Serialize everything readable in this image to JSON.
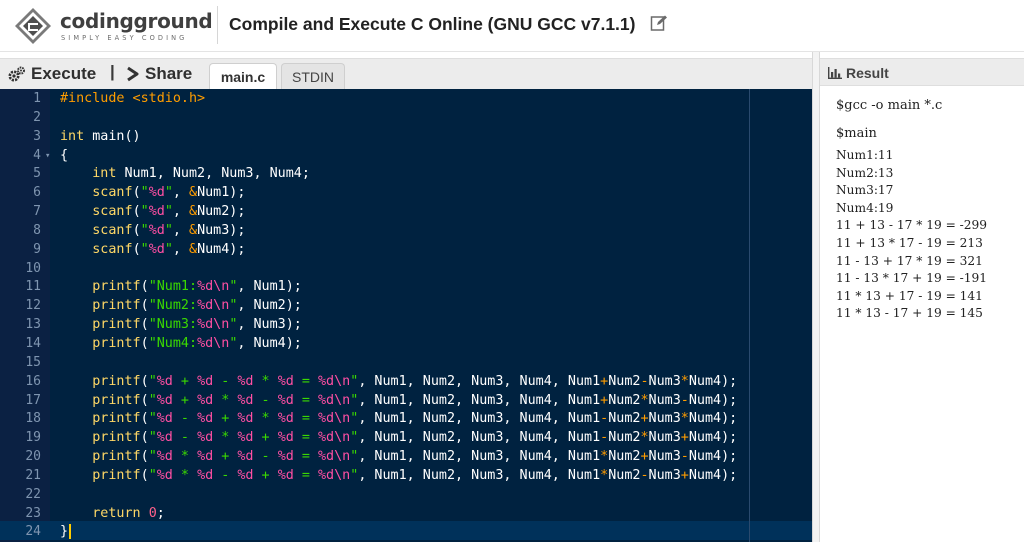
{
  "header": {
    "logo_name": "codingground",
    "logo_tagline": "SIMPLY EASY CODING",
    "page_title": "Compile and Execute C Online (GNU GCC v7.1.1)",
    "edit_icon": "edit-icon"
  },
  "toolbar": {
    "execute_label": "Execute",
    "separator": "|",
    "share_label": "Share",
    "tabs": [
      {
        "label": "main.c",
        "active": true
      },
      {
        "label": "STDIN",
        "active": false
      }
    ]
  },
  "editor": {
    "active_line": 24,
    "lines": [
      {
        "n": "1",
        "tokens": [
          [
            "pp",
            "#include <stdio.h>"
          ]
        ]
      },
      {
        "n": "2",
        "tokens": []
      },
      {
        "n": "3",
        "tokens": [
          [
            "kw",
            "int"
          ],
          [
            "plain",
            " main()"
          ]
        ]
      },
      {
        "n": "4",
        "fold": true,
        "tokens": [
          [
            "plain",
            "{"
          ]
        ]
      },
      {
        "n": "5",
        "tokens": [
          [
            "plain",
            "    "
          ],
          [
            "kw",
            "int"
          ],
          [
            "plain",
            " Num1, Num2, Num3, Num4;"
          ]
        ]
      },
      {
        "n": "6",
        "tokens": [
          [
            "plain",
            "    "
          ],
          [
            "kw",
            "scanf"
          ],
          [
            "plain",
            "("
          ],
          [
            "str",
            "\""
          ],
          [
            "fmt",
            "%d"
          ],
          [
            "str",
            "\""
          ],
          [
            "plain",
            ", "
          ],
          [
            "op",
            "&"
          ],
          [
            "plain",
            "Num1);"
          ]
        ]
      },
      {
        "n": "7",
        "tokens": [
          [
            "plain",
            "    "
          ],
          [
            "kw",
            "scanf"
          ],
          [
            "plain",
            "("
          ],
          [
            "str",
            "\""
          ],
          [
            "fmt",
            "%d"
          ],
          [
            "str",
            "\""
          ],
          [
            "plain",
            ", "
          ],
          [
            "op",
            "&"
          ],
          [
            "plain",
            "Num2);"
          ]
        ]
      },
      {
        "n": "8",
        "tokens": [
          [
            "plain",
            "    "
          ],
          [
            "kw",
            "scanf"
          ],
          [
            "plain",
            "("
          ],
          [
            "str",
            "\""
          ],
          [
            "fmt",
            "%d"
          ],
          [
            "str",
            "\""
          ],
          [
            "plain",
            ", "
          ],
          [
            "op",
            "&"
          ],
          [
            "plain",
            "Num3);"
          ]
        ]
      },
      {
        "n": "9",
        "tokens": [
          [
            "plain",
            "    "
          ],
          [
            "kw",
            "scanf"
          ],
          [
            "plain",
            "("
          ],
          [
            "str",
            "\""
          ],
          [
            "fmt",
            "%d"
          ],
          [
            "str",
            "\""
          ],
          [
            "plain",
            ", "
          ],
          [
            "op",
            "&"
          ],
          [
            "plain",
            "Num4);"
          ]
        ]
      },
      {
        "n": "10",
        "tokens": []
      },
      {
        "n": "11",
        "tokens": [
          [
            "plain",
            "    "
          ],
          [
            "kw",
            "printf"
          ],
          [
            "plain",
            "("
          ],
          [
            "str",
            "\"Num1:"
          ],
          [
            "fmt",
            "%d\\n"
          ],
          [
            "str",
            "\""
          ],
          [
            "plain",
            ", Num1);"
          ]
        ]
      },
      {
        "n": "12",
        "tokens": [
          [
            "plain",
            "    "
          ],
          [
            "kw",
            "printf"
          ],
          [
            "plain",
            "("
          ],
          [
            "str",
            "\"Num2:"
          ],
          [
            "fmt",
            "%d\\n"
          ],
          [
            "str",
            "\""
          ],
          [
            "plain",
            ", Num2);"
          ]
        ]
      },
      {
        "n": "13",
        "tokens": [
          [
            "plain",
            "    "
          ],
          [
            "kw",
            "printf"
          ],
          [
            "plain",
            "("
          ],
          [
            "str",
            "\"Num3:"
          ],
          [
            "fmt",
            "%d\\n"
          ],
          [
            "str",
            "\""
          ],
          [
            "plain",
            ", Num3);"
          ]
        ]
      },
      {
        "n": "14",
        "tokens": [
          [
            "plain",
            "    "
          ],
          [
            "kw",
            "printf"
          ],
          [
            "plain",
            "("
          ],
          [
            "str",
            "\"Num4:"
          ],
          [
            "fmt",
            "%d\\n"
          ],
          [
            "str",
            "\""
          ],
          [
            "plain",
            ", Num4);"
          ]
        ]
      },
      {
        "n": "15",
        "tokens": []
      },
      {
        "n": "16",
        "tokens": [
          [
            "plain",
            "    "
          ],
          [
            "kw",
            "printf"
          ],
          [
            "plain",
            "("
          ],
          [
            "str",
            "\""
          ],
          [
            "fmt",
            "%d"
          ],
          [
            "str",
            " + "
          ],
          [
            "fmt",
            "%d"
          ],
          [
            "str",
            " - "
          ],
          [
            "fmt",
            "%d"
          ],
          [
            "str",
            " * "
          ],
          [
            "fmt",
            "%d"
          ],
          [
            "str",
            " = "
          ],
          [
            "fmt",
            "%d\\n"
          ],
          [
            "str",
            "\""
          ],
          [
            "plain",
            ", Num1, Num2, Num3, Num4, Num1"
          ],
          [
            "op",
            "+"
          ],
          [
            "plain",
            "Num2"
          ],
          [
            "op",
            "-"
          ],
          [
            "plain",
            "Num3"
          ],
          [
            "op",
            "*"
          ],
          [
            "plain",
            "Num4);"
          ]
        ]
      },
      {
        "n": "17",
        "tokens": [
          [
            "plain",
            "    "
          ],
          [
            "kw",
            "printf"
          ],
          [
            "plain",
            "("
          ],
          [
            "str",
            "\""
          ],
          [
            "fmt",
            "%d"
          ],
          [
            "str",
            " + "
          ],
          [
            "fmt",
            "%d"
          ],
          [
            "str",
            " * "
          ],
          [
            "fmt",
            "%d"
          ],
          [
            "str",
            " - "
          ],
          [
            "fmt",
            "%d"
          ],
          [
            "str",
            " = "
          ],
          [
            "fmt",
            "%d\\n"
          ],
          [
            "str",
            "\""
          ],
          [
            "plain",
            ", Num1, Num2, Num3, Num4, Num1"
          ],
          [
            "op",
            "+"
          ],
          [
            "plain",
            "Num2"
          ],
          [
            "op",
            "*"
          ],
          [
            "plain",
            "Num3"
          ],
          [
            "op",
            "-"
          ],
          [
            "plain",
            "Num4);"
          ]
        ]
      },
      {
        "n": "18",
        "tokens": [
          [
            "plain",
            "    "
          ],
          [
            "kw",
            "printf"
          ],
          [
            "plain",
            "("
          ],
          [
            "str",
            "\""
          ],
          [
            "fmt",
            "%d"
          ],
          [
            "str",
            " - "
          ],
          [
            "fmt",
            "%d"
          ],
          [
            "str",
            " + "
          ],
          [
            "fmt",
            "%d"
          ],
          [
            "str",
            " * "
          ],
          [
            "fmt",
            "%d"
          ],
          [
            "str",
            " = "
          ],
          [
            "fmt",
            "%d\\n"
          ],
          [
            "str",
            "\""
          ],
          [
            "plain",
            ", Num1, Num2, Num3, Num4, Num1"
          ],
          [
            "op",
            "-"
          ],
          [
            "plain",
            "Num2"
          ],
          [
            "op",
            "+"
          ],
          [
            "plain",
            "Num3"
          ],
          [
            "op",
            "*"
          ],
          [
            "plain",
            "Num4);"
          ]
        ]
      },
      {
        "n": "19",
        "tokens": [
          [
            "plain",
            "    "
          ],
          [
            "kw",
            "printf"
          ],
          [
            "plain",
            "("
          ],
          [
            "str",
            "\""
          ],
          [
            "fmt",
            "%d"
          ],
          [
            "str",
            " - "
          ],
          [
            "fmt",
            "%d"
          ],
          [
            "str",
            " * "
          ],
          [
            "fmt",
            "%d"
          ],
          [
            "str",
            " + "
          ],
          [
            "fmt",
            "%d"
          ],
          [
            "str",
            " = "
          ],
          [
            "fmt",
            "%d\\n"
          ],
          [
            "str",
            "\""
          ],
          [
            "plain",
            ", Num1, Num2, Num3, Num4, Num1"
          ],
          [
            "op",
            "-"
          ],
          [
            "plain",
            "Num2"
          ],
          [
            "op",
            "*"
          ],
          [
            "plain",
            "Num3"
          ],
          [
            "op",
            "+"
          ],
          [
            "plain",
            "Num4);"
          ]
        ]
      },
      {
        "n": "20",
        "tokens": [
          [
            "plain",
            "    "
          ],
          [
            "kw",
            "printf"
          ],
          [
            "plain",
            "("
          ],
          [
            "str",
            "\""
          ],
          [
            "fmt",
            "%d"
          ],
          [
            "str",
            " * "
          ],
          [
            "fmt",
            "%d"
          ],
          [
            "str",
            " + "
          ],
          [
            "fmt",
            "%d"
          ],
          [
            "str",
            " - "
          ],
          [
            "fmt",
            "%d"
          ],
          [
            "str",
            " = "
          ],
          [
            "fmt",
            "%d\\n"
          ],
          [
            "str",
            "\""
          ],
          [
            "plain",
            ", Num1, Num2, Num3, Num4, Num1"
          ],
          [
            "op",
            "*"
          ],
          [
            "plain",
            "Num2"
          ],
          [
            "op",
            "+"
          ],
          [
            "plain",
            "Num3"
          ],
          [
            "op",
            "-"
          ],
          [
            "plain",
            "Num4);"
          ]
        ]
      },
      {
        "n": "21",
        "tokens": [
          [
            "plain",
            "    "
          ],
          [
            "kw",
            "printf"
          ],
          [
            "plain",
            "("
          ],
          [
            "str",
            "\""
          ],
          [
            "fmt",
            "%d"
          ],
          [
            "str",
            " * "
          ],
          [
            "fmt",
            "%d"
          ],
          [
            "str",
            " - "
          ],
          [
            "fmt",
            "%d"
          ],
          [
            "str",
            " + "
          ],
          [
            "fmt",
            "%d"
          ],
          [
            "str",
            " = "
          ],
          [
            "fmt",
            "%d\\n"
          ],
          [
            "str",
            "\""
          ],
          [
            "plain",
            ", Num1, Num2, Num3, Num4, Num1"
          ],
          [
            "op",
            "*"
          ],
          [
            "plain",
            "Num2"
          ],
          [
            "op",
            "-"
          ],
          [
            "plain",
            "Num3"
          ],
          [
            "op",
            "+"
          ],
          [
            "plain",
            "Num4);"
          ]
        ]
      },
      {
        "n": "22",
        "tokens": []
      },
      {
        "n": "23",
        "tokens": [
          [
            "plain",
            "    "
          ],
          [
            "kw",
            "return"
          ],
          [
            "plain",
            " "
          ],
          [
            "num",
            "0"
          ],
          [
            "plain",
            ";"
          ]
        ]
      },
      {
        "n": "24",
        "caret": true,
        "tokens": [
          [
            "plain",
            "}"
          ]
        ]
      }
    ]
  },
  "result": {
    "title": "Result",
    "command": "$gcc -o main *.c",
    "run": "$main",
    "output": [
      "Num1:11",
      "Num2:13",
      "Num3:17",
      "Num4:19",
      "11 + 13 - 17 * 19 = -299",
      "11 + 13 * 17 - 19 = 213",
      "11 - 13 + 17 * 19 = 321",
      "11 - 13 * 17 + 19 = -191",
      "11 * 13 + 17 - 19 = 141",
      "11 * 13 - 17 + 19 = 145"
    ]
  },
  "colors": {
    "editor_bg": "#002240",
    "keyword": "#ffd866",
    "string": "#3ad900",
    "format": "#ff4fa3",
    "preprocessor": "#ff9d00"
  }
}
